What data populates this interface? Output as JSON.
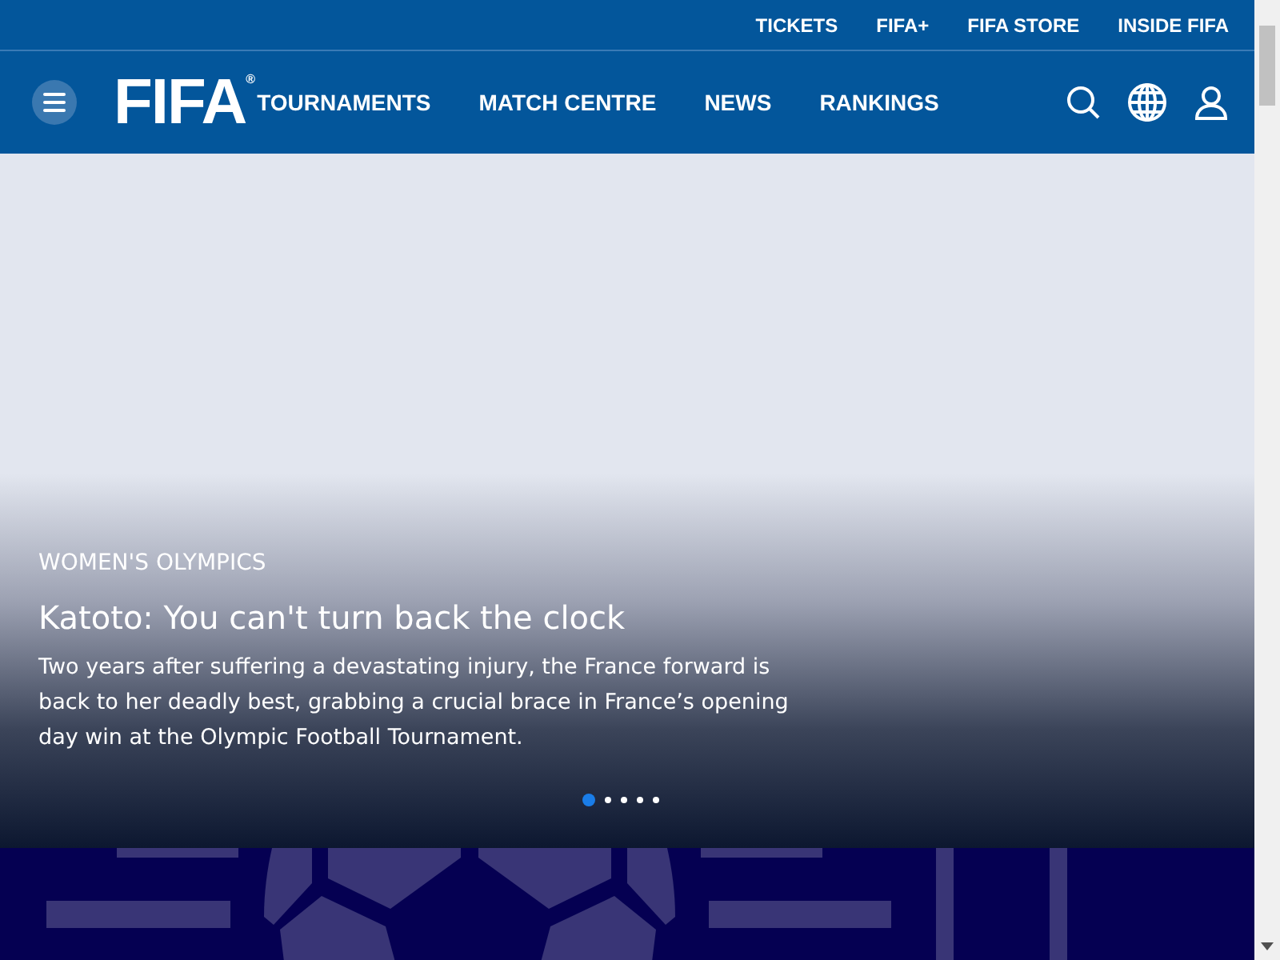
{
  "utility_nav": {
    "links": [
      "TICKETS",
      "FIFA+",
      "FIFA STORE",
      "INSIDE FIFA"
    ]
  },
  "main_nav": {
    "logo": {
      "text": "FIFA",
      "mark": "®"
    },
    "links": [
      "TOURNAMENTS",
      "MATCH CENTRE",
      "NEWS",
      "RANKINGS"
    ]
  },
  "hero": {
    "category": "WOMEN'S OLYMPICS",
    "title": "Katoto: You can't turn back the clock",
    "summary": "Two years after suffering a devastating injury, the France forward is back to her deadly best, grabbing a crucial brace in France’s opening day win at the Olympic Football Tournament.",
    "dots": [
      {
        "selected": true
      },
      {
        "selected": false
      },
      {
        "selected": false
      },
      {
        "selected": false
      },
      {
        "selected": false
      }
    ]
  }
}
